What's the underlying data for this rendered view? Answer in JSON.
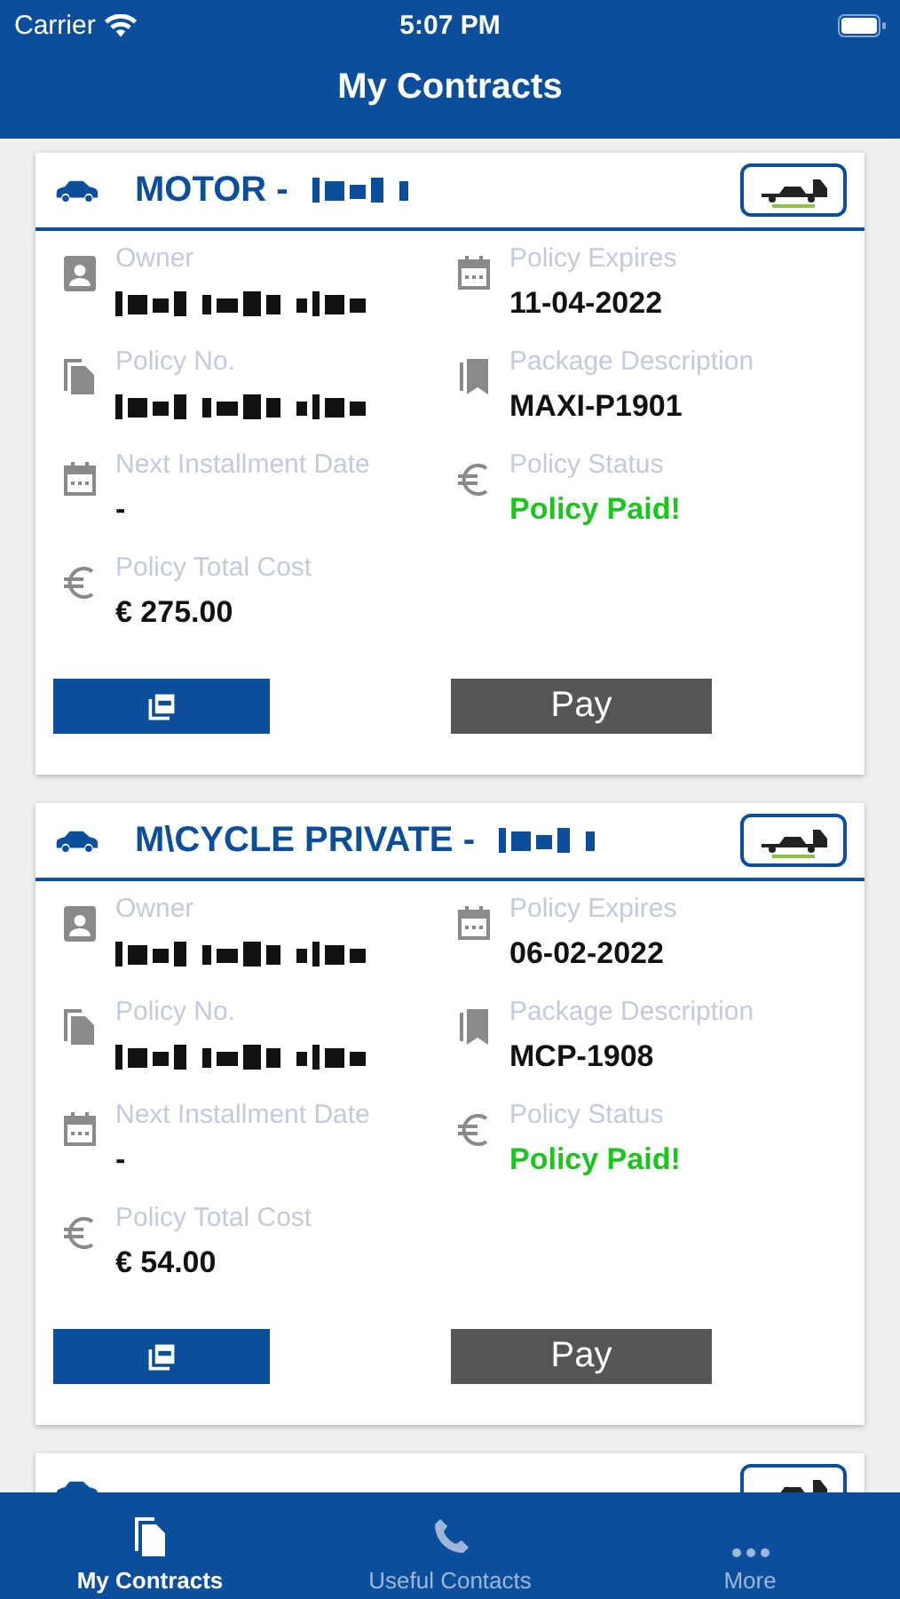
{
  "status_bar": {
    "carrier": "Carrier",
    "time": "5:07 PM"
  },
  "title": "My Contracts",
  "contracts": [
    {
      "kind": "full",
      "vehicle": "MOTOR -",
      "plate_redacted": true,
      "fields": [
        {
          "kind": "owner",
          "label": "Owner",
          "redacted": true
        },
        {
          "kind": "expires",
          "label": "Policy Expires",
          "value": "11-04-2022"
        },
        {
          "kind": "policy_no",
          "label": "Policy No.",
          "redacted": true
        },
        {
          "kind": "package",
          "label": "Package Description",
          "value": "MAXI-P1901"
        },
        {
          "kind": "installment",
          "label": "Next Installment Date",
          "value": "-"
        },
        {
          "kind": "status",
          "label": "Policy Status",
          "value": "Policy Paid!"
        },
        {
          "kind": "cost",
          "label": "Policy Total Cost",
          "value": "€ 275.00"
        }
      ],
      "pay_label": "Pay"
    },
    {
      "kind": "full",
      "vehicle": "M\\CYCLE PRIVATE -",
      "plate_redacted": true,
      "fields": [
        {
          "kind": "owner",
          "label": "Owner",
          "redacted": true
        },
        {
          "kind": "expires",
          "label": "Policy Expires",
          "value": "06-02-2022"
        },
        {
          "kind": "policy_no",
          "label": "Policy No.",
          "redacted": true
        },
        {
          "kind": "package",
          "label": "Package Description",
          "value": "MCP-1908"
        },
        {
          "kind": "installment",
          "label": "Next Installment Date",
          "value": "-"
        },
        {
          "kind": "status",
          "label": "Policy Status",
          "value": "Policy Paid!"
        },
        {
          "kind": "cost",
          "label": "Policy Total Cost",
          "value": "€ 54.00"
        }
      ],
      "pay_label": "Pay"
    },
    {
      "kind": "peek"
    }
  ],
  "tabs": [
    {
      "kind": "contracts",
      "label": "My Contracts",
      "selected": true
    },
    {
      "kind": "contacts",
      "label": "Useful Contacts",
      "selected": false
    },
    {
      "kind": "more",
      "label": "More",
      "selected": false
    }
  ]
}
